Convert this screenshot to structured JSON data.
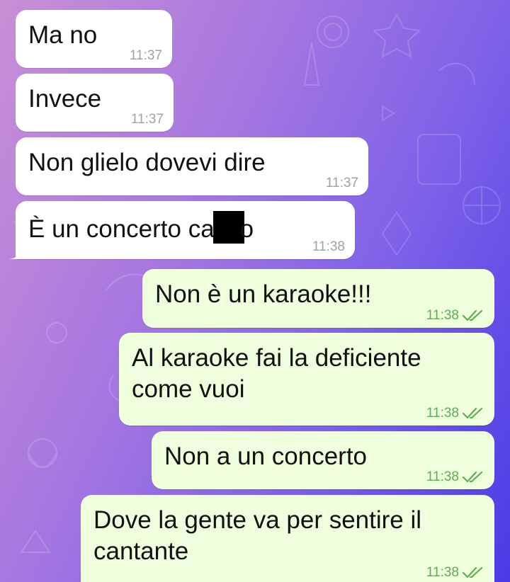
{
  "incoming": [
    {
      "text": "Ma no",
      "time": "11:37"
    },
    {
      "text": "Invece",
      "time": "11:37"
    },
    {
      "text": "Non glielo dovevi dire",
      "time": "11:37"
    },
    {
      "text_a": "È un concerto ca",
      "text_b": "o",
      "time": "11:38"
    }
  ],
  "outgoing": [
    {
      "text": "Non è un karaoke!!!",
      "time": "11:38"
    },
    {
      "line1": "Al karaoke fai la deficiente",
      "line2": "come vuoi",
      "time": "11:38"
    },
    {
      "text": "Non a un concerto",
      "time": "11:38"
    },
    {
      "line1": "Dove la gente va per sentire il",
      "line2": "cantante",
      "time": "11:38"
    }
  ],
  "colors": {
    "incoming_bubble": "#ffffff",
    "outgoing_bubble": "#effedd",
    "read_check": "#5fae52",
    "time_incoming": "#9ba3ab"
  },
  "icons": {
    "read_receipt": "double-check-icon"
  }
}
